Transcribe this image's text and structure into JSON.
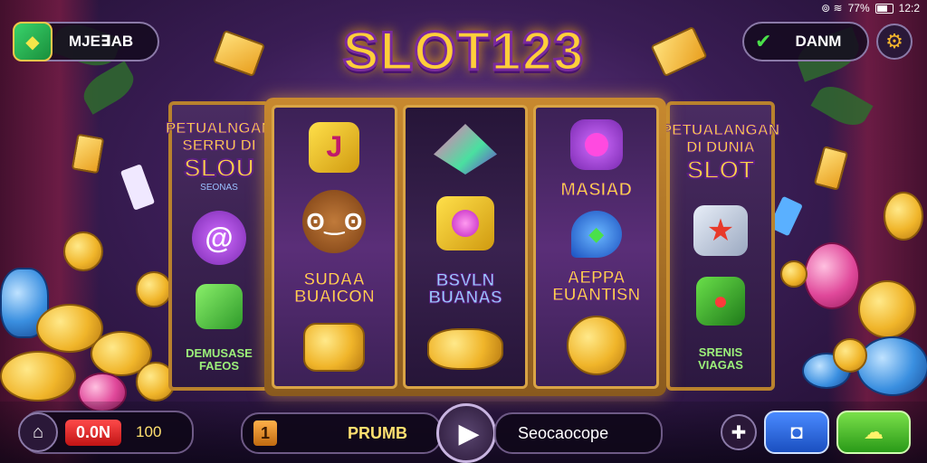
{
  "status_bar": {
    "battery": "77%",
    "time": "12:2"
  },
  "header": {
    "player_name": "MJE∃AB",
    "logo": "SLOT123",
    "right_label": "DANM"
  },
  "left_panel": {
    "title_line1": "PETUALNGAN",
    "title_line2": "SERRU DI",
    "title_big": "SLOU",
    "subtitle": "SEONAS",
    "footer_line1": "DEMUSASE",
    "footer_line2": "FAEOS"
  },
  "right_panel": {
    "title_line1": "PETUALANGAN",
    "title_line2": "DI DUNIA",
    "title_big": "SLOT",
    "footer_line1": "SRENIS",
    "footer_line2": "VIAGAS"
  },
  "reels": [
    {
      "label_line1": "SUDAA",
      "label_line2": "BUAICON"
    },
    {
      "label_line1": "BSVLN",
      "label_line2": "BUANAS"
    },
    {
      "top_label": "MASIAD",
      "label_line1": "AEPPA",
      "label_line2": "EUANTISN"
    }
  ],
  "bottom_bar": {
    "bet_button": "0.0N",
    "bet_value": "100",
    "line_count": "1",
    "promo_label": "PRUMB",
    "mode_label": "Seocaocope"
  },
  "icons": [
    "gem-icon",
    "check-icon",
    "gear-icon",
    "home-icon",
    "play-icon",
    "plus-icon",
    "camera-icon",
    "cloud-icon"
  ],
  "colors": {
    "accent_gold": "#ffcf3a",
    "frame_gold": "#c8892f",
    "purple_bg": "#3a1d55",
    "red_button": "#c01414",
    "blue_button": "#1a4fc0",
    "green_button": "#2a9a18"
  }
}
